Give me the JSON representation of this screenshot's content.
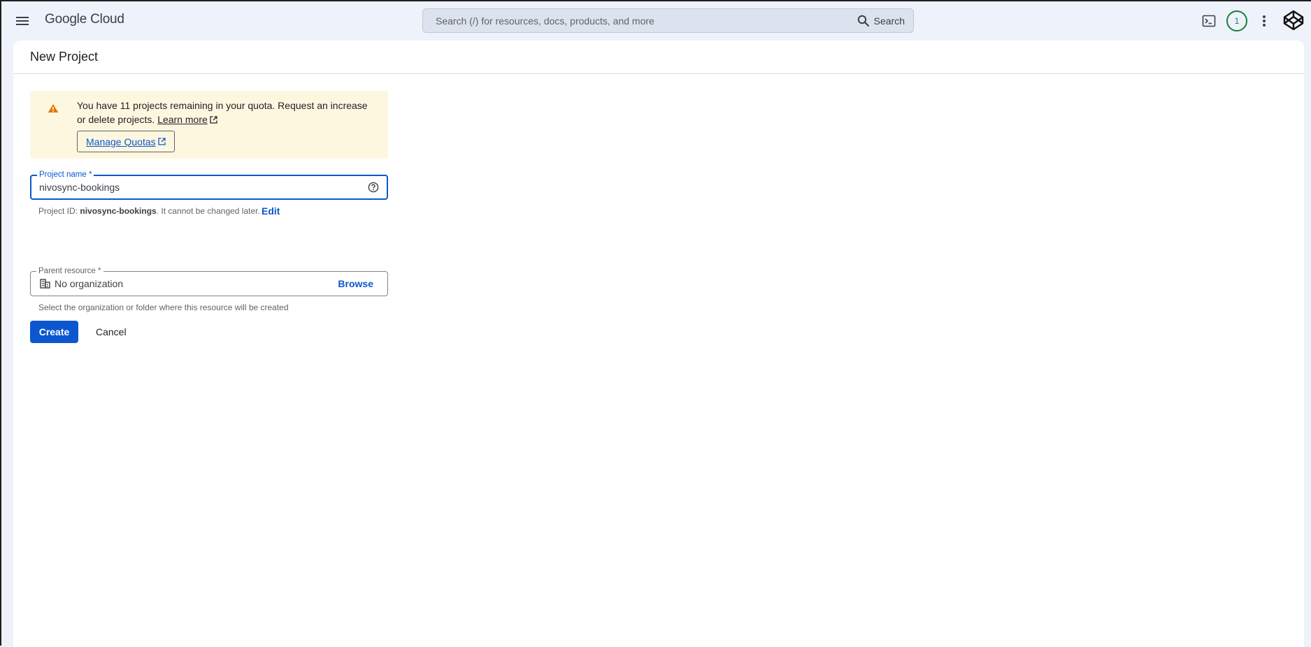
{
  "topbar": {
    "brand": "Google Cloud",
    "search_placeholder": "Search (/) for resources, docs, products, and more",
    "search_button": "Search",
    "notification_count": "1"
  },
  "page": {
    "title": "New Project"
  },
  "alert": {
    "message": "You have 11 projects remaining in your quota. Request an increase or delete projects.",
    "learn_more": "Learn more",
    "manage_quotas": "Manage Quotas",
    "color": "#fef7e0"
  },
  "form": {
    "project_name": {
      "label": "Project name *",
      "value": "nivosync-bookings"
    },
    "project_id": {
      "prefix": "Project ID:",
      "value": "nivosync-bookings",
      "suffix": ". It cannot be changed later.",
      "edit": "Edit"
    },
    "parent_resource": {
      "label": "Parent resource *",
      "value": "No organization",
      "browse": "Browse",
      "hint": "Select the organization or folder where this resource will be created"
    }
  },
  "actions": {
    "create": "Create",
    "cancel": "Cancel"
  },
  "colors": {
    "primary": "#0b57d0",
    "warning_icon": "#e37400",
    "badge": "#188038"
  }
}
